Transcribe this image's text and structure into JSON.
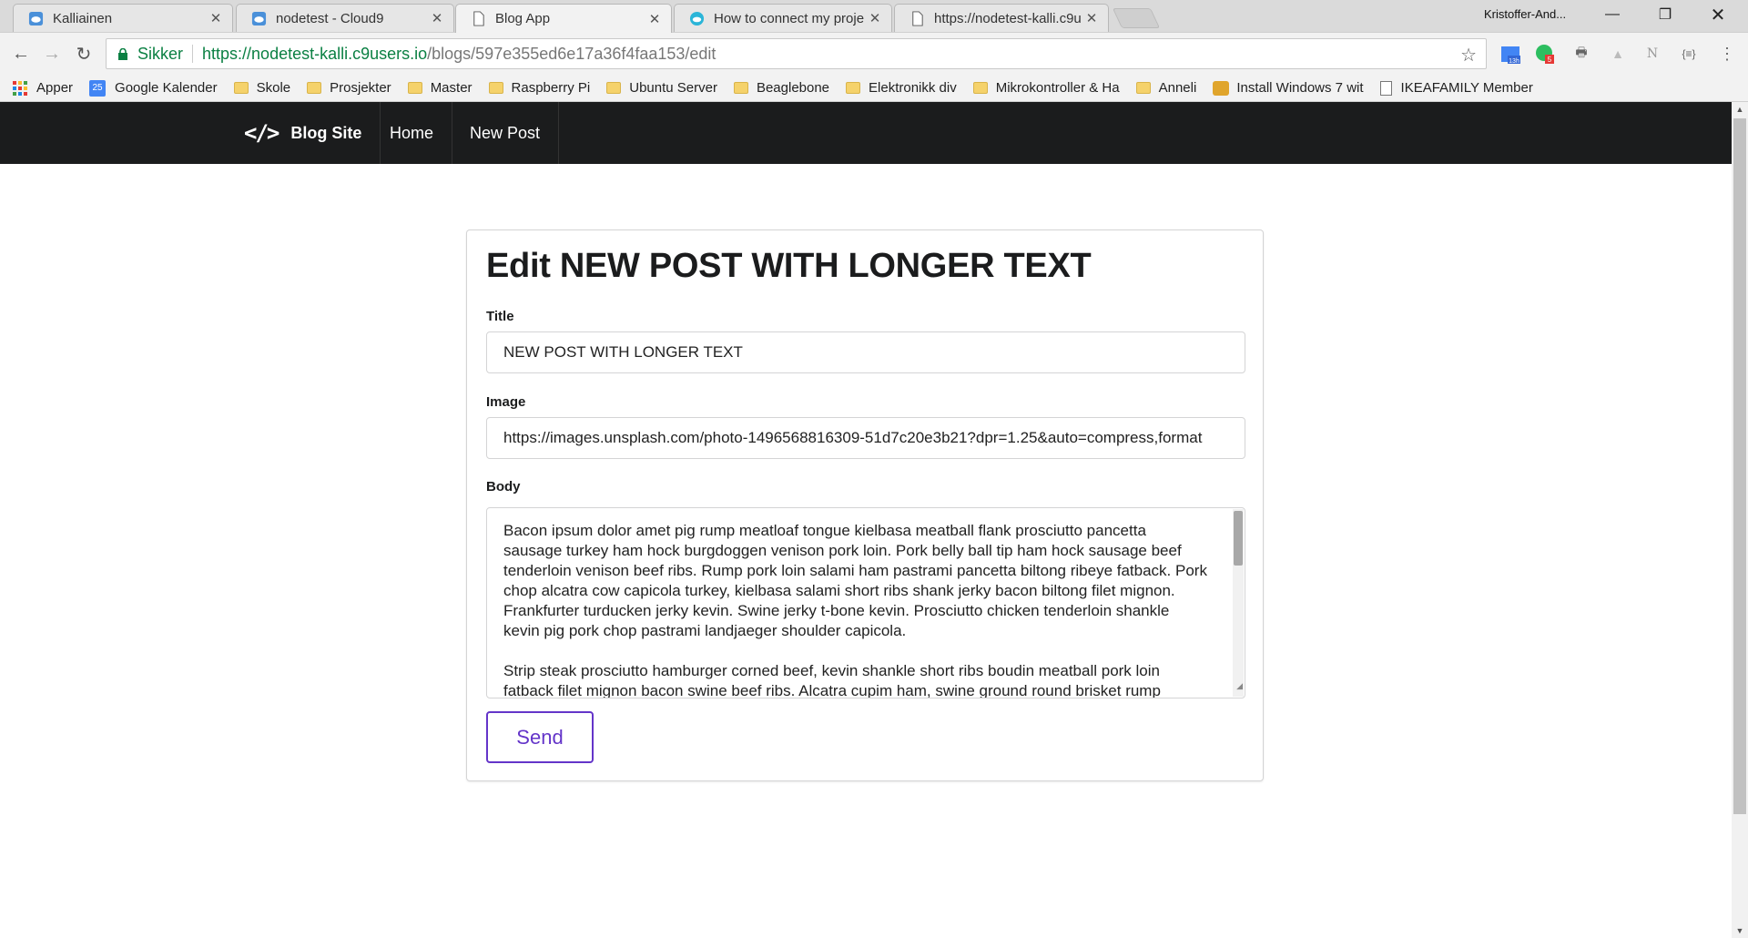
{
  "browser": {
    "tabs": [
      {
        "title": "Kalliainen",
        "icon": "cloud9-icon"
      },
      {
        "title": "nodetest - Cloud9",
        "icon": "cloud9-icon"
      },
      {
        "title": "Blog App",
        "icon": "page-icon"
      },
      {
        "title": "How to connect my proje",
        "icon": "cloud9-icon"
      },
      {
        "title": "https://nodetest-kalli.c9u",
        "icon": "page-icon"
      }
    ],
    "profile_name": "Kristoffer-And...",
    "secure_label": "Sikker",
    "url_host": "https://nodetest-kalli.c9users.io",
    "url_path": "/blogs/597e355ed6e17a36f4faa153/edit",
    "extension_badges": {
      "calendar": "13h",
      "evernote": "5"
    },
    "bookmarks": [
      {
        "label": "Apper",
        "icon": "apps-icon"
      },
      {
        "label": "Google Kalender",
        "icon": "calendar-icon",
        "badge": "25"
      },
      {
        "label": "Skole",
        "icon": "folder-icon"
      },
      {
        "label": "Prosjekter",
        "icon": "folder-icon"
      },
      {
        "label": "Master",
        "icon": "folder-icon"
      },
      {
        "label": "Raspberry Pi",
        "icon": "folder-icon"
      },
      {
        "label": "Ubuntu Server",
        "icon": "folder-icon"
      },
      {
        "label": "Beaglebone",
        "icon": "folder-icon"
      },
      {
        "label": "Elektronikk div",
        "icon": "folder-icon"
      },
      {
        "label": "Mikrokontroller & Ha",
        "icon": "folder-icon"
      },
      {
        "label": "Anneli",
        "icon": "folder-icon"
      },
      {
        "label": "Install Windows 7 wit",
        "icon": "gift-icon"
      },
      {
        "label": "IKEAFAMILY Member",
        "icon": "page-icon"
      }
    ]
  },
  "site": {
    "brand": "Blog Site",
    "nav": {
      "home": "Home",
      "new_post": "New Post"
    }
  },
  "form": {
    "heading": "Edit NEW POST WITH LONGER TEXT",
    "title_label": "Title",
    "title_value": "NEW POST WITH LONGER TEXT",
    "image_label": "Image",
    "image_value": "https://images.unsplash.com/photo-1496568816309-51d7c20e3b21?dpr=1.25&auto=compress,format",
    "body_label": "Body",
    "body_paragraph_1": "Bacon ipsum dolor amet pig rump meatloaf tongue kielbasa meatball flank prosciutto pancetta sausage turkey ham hock burgdoggen venison pork loin. Pork belly ball tip ham hock sausage beef tenderloin venison beef ribs. Rump pork loin salami ham pastrami pancetta biltong ribeye fatback. Pork chop alcatra cow capicola turkey, kielbasa salami short ribs shank jerky bacon biltong filet mignon. Frankfurter turducken jerky kevin. Swine jerky t-bone kevin. Prosciutto chicken tenderloin shankle kevin pig pork chop pastrami landjaeger shoulder capicola.",
    "body_paragraph_2": "Strip steak prosciutto hamburger corned beef, kevin shankle short ribs boudin meatball pork loin fatback filet mignon bacon swine beef ribs. Alcatra cupim ham, swine ground round brisket rump",
    "send_label": "Send"
  },
  "colors": {
    "send_accent": "#6435c9",
    "navbar": "#1b1c1d",
    "secure_green": "#0b8043"
  }
}
